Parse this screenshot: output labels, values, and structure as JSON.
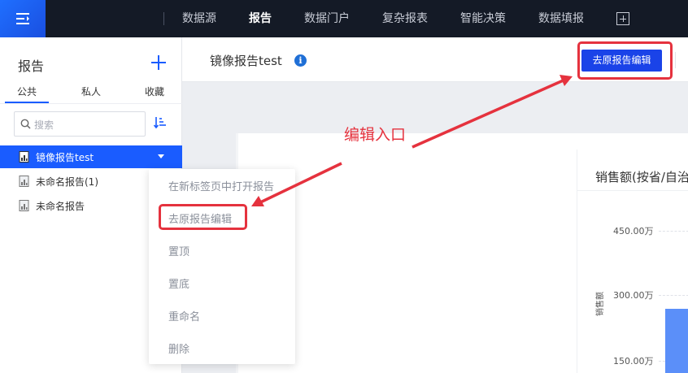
{
  "topbar": {
    "nav": [
      {
        "label": "数据源",
        "active": false
      },
      {
        "label": "报告",
        "active": true
      },
      {
        "label": "数据门户",
        "active": false
      },
      {
        "label": "复杂报表",
        "active": false
      },
      {
        "label": "智能决策",
        "active": false
      },
      {
        "label": "数据填报",
        "active": false
      }
    ],
    "menu_icon": "hamburger-icon",
    "add_icon": "add-square-icon"
  },
  "sidebar": {
    "title": "报告",
    "tabs": [
      "公共",
      "私人",
      "收藏"
    ],
    "active_tab": "公共",
    "search": {
      "placeholder": "搜索"
    },
    "items": [
      {
        "label": "镜像报告test",
        "selected": true
      },
      {
        "label": "未命名报告(1)",
        "selected": false
      },
      {
        "label": "未命名报告",
        "selected": false
      }
    ]
  },
  "context_menu": {
    "items": [
      "在新标签页中打开报告",
      "去原报告编辑",
      "置顶",
      "置底",
      "重命名",
      "删除"
    ]
  },
  "main": {
    "title": "镜像报告test",
    "edit_button": "去原报告编辑",
    "annotation": "编辑入口"
  },
  "chart_data": {
    "type": "bar",
    "title": "销售额(按省/自治",
    "ylabel": "销售额",
    "yticks": [
      "450.00万",
      "300.00万",
      "150.00万"
    ]
  },
  "colors": {
    "accent": "#1a5cff",
    "topbar": "#141a26",
    "highlight": "#e5323e",
    "bar": "#5b8ff9"
  }
}
